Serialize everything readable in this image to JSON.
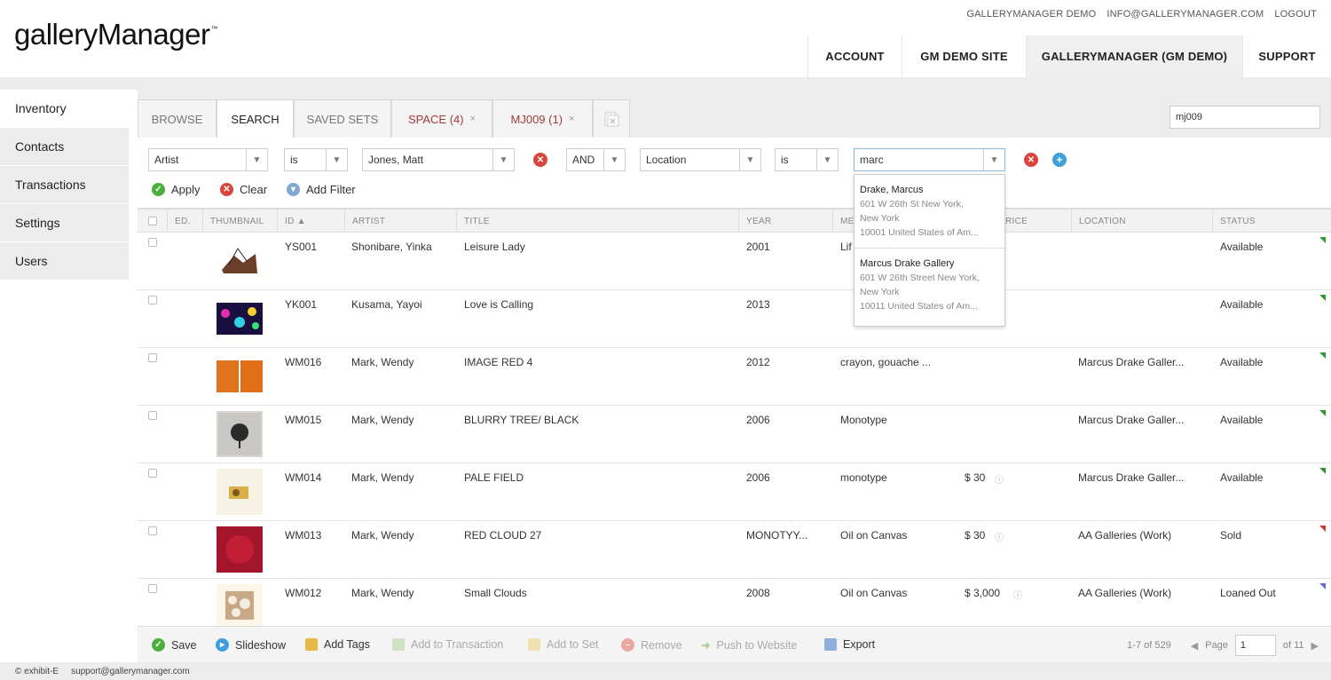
{
  "brand": {
    "name": "galleryManager",
    "tm": "™"
  },
  "top_links": [
    "GALLERYMANAGER DEMO",
    "INFO@GALLERYMANAGER.COM",
    "LOGOUT"
  ],
  "main_nav": [
    "ACCOUNT",
    "GM DEMO SITE",
    "GALLERYMANAGER (GM DEMO)",
    "SUPPORT"
  ],
  "sidebar": [
    "Inventory",
    "Contacts",
    "Transactions",
    "Settings",
    "Users"
  ],
  "tabs": {
    "browse": "BROWSE",
    "search": "SEARCH",
    "saved_sets": "SAVED SETS",
    "space": "SPACE (4)",
    "mj009": "MJ009 (1)",
    "close": "×"
  },
  "quick_search": {
    "value": "mj009"
  },
  "filters": {
    "field1": "Artist",
    "op1": "is",
    "value1": "Jones, Matt",
    "conjunction": "AND",
    "field2": "Location",
    "op2": "is",
    "value2": "marc"
  },
  "filter_actions": {
    "apply": "Apply",
    "clear": "Clear",
    "add_filter": "Add Filter"
  },
  "columns": [
    "ED.",
    "THUMBNAIL",
    "ID ▲",
    "ARTIST",
    "TITLE",
    "YEAR",
    "ME",
    "RICE",
    "LOCATION",
    "STATUS"
  ],
  "rows": [
    {
      "id": "YS001",
      "artist": "Shonibare, Yinka",
      "title": "Leisure Lady",
      "year": "2001",
      "medium": "Lif",
      "price": "",
      "location": "",
      "status": "Available",
      "flag": "#2e9a2e"
    },
    {
      "id": "YK001",
      "artist": "Kusama, Yayoi",
      "title": "Love is Calling",
      "year": "2013",
      "medium": "",
      "price": "",
      "location": "",
      "status": "Available",
      "flag": "#2e9a2e"
    },
    {
      "id": "WM016",
      "artist": "Mark, Wendy",
      "title": "IMAGE RED 4",
      "year": "2012",
      "medium": "crayon, gouache ...",
      "price": "",
      "location": "Marcus Drake Galler...",
      "status": "Available",
      "flag": "#2e9a2e"
    },
    {
      "id": "WM015",
      "artist": "Mark, Wendy",
      "title": "BLURRY TREE/ BLACK",
      "year": "2006",
      "medium": "Monotype",
      "price": "",
      "location": "Marcus Drake Galler...",
      "status": "Available",
      "flag": "#2e9a2e"
    },
    {
      "id": "WM014",
      "artist": "Mark, Wendy",
      "title": "PALE FIELD",
      "year": "2006",
      "medium": "monotype",
      "price": "$ 30",
      "location": "Marcus Drake Galler...",
      "status": "Available",
      "flag": "#2e9a2e"
    },
    {
      "id": "WM013",
      "artist": "Mark, Wendy",
      "title": "RED CLOUD 27",
      "year": "MONOTYY...",
      "medium": "Oil on Canvas",
      "price": "$ 30",
      "location": "AA Galleries (Work)",
      "status": "Sold",
      "flag": "#d33030"
    },
    {
      "id": "WM012",
      "artist": "Mark, Wendy",
      "title": "Small Clouds",
      "year": "2008",
      "medium": "Oil on Canvas",
      "price": "$ 3,000",
      "location": "AA Galleries (Work)",
      "status": "Loaned Out",
      "flag": "#6a6ad0"
    }
  ],
  "dropdown": [
    {
      "name": "Drake, Marcus",
      "addr1": "601 W 26th St New York,",
      "addr2": "New York",
      "addr3": "10001 United States of Am..."
    },
    {
      "name": "Marcus Drake Gallery",
      "addr1": "601 W 26th Street New York,",
      "addr2": "New York",
      "addr3": "10011 United States of Am..."
    }
  ],
  "footer_actions": {
    "save": "Save",
    "slideshow": "Slideshow",
    "add_tags": "Add Tags",
    "add_to_transaction": "Add to Transaction",
    "add_to_set": "Add to Set",
    "remove": "Remove",
    "push_to_website": "Push to Website",
    "export": "Export"
  },
  "pager": {
    "range": "1-7 of 529",
    "page_label": "Page",
    "page": "1",
    "of": "of 11"
  },
  "bottom": {
    "copyright": "© exhibit-E",
    "email": "support@gallerymanager.com"
  }
}
